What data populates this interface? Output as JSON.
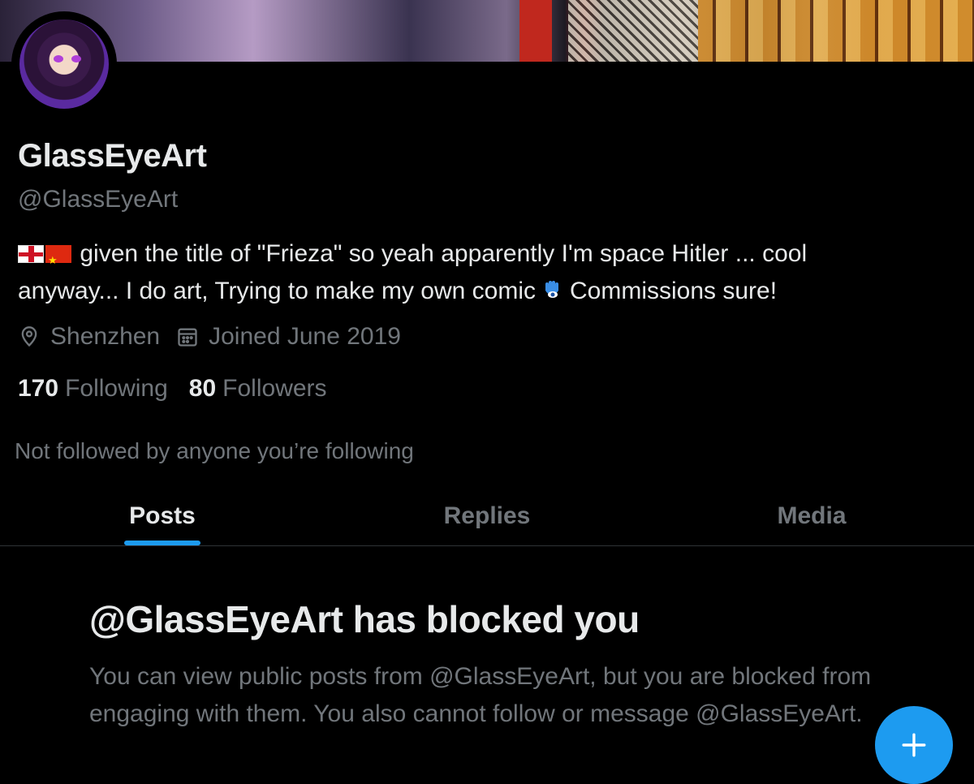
{
  "profile": {
    "display_name": "GlassEyeArt",
    "handle": "@GlassEyeArt",
    "bio_line1": "given the title of \"Frieza\" so yeah apparently I'm space Hitler ... cool",
    "bio_line2_a": "anyway... I do art, Trying to make my own comic",
    "bio_line2_b": "Commissions sure!",
    "location": "Shenzhen",
    "joined": "Joined June 2019",
    "following_count": "170",
    "following_label": "Following",
    "followers_count": "80",
    "followers_label": "Followers",
    "not_followed_text": "Not followed by anyone you’re following"
  },
  "tabs": [
    {
      "label": "Posts",
      "active": true
    },
    {
      "label": "Replies",
      "active": false
    },
    {
      "label": "Media",
      "active": false
    }
  ],
  "blocked": {
    "title": "@GlassEyeArt has blocked you",
    "message": "You can view public posts from @GlassEyeArt, but you are blocked from engaging with them. You also cannot follow or message @GlassEyeArt."
  },
  "icons": {
    "location": "location-pin-icon",
    "calendar": "calendar-icon",
    "compose": "plus-icon"
  },
  "colors": {
    "accent": "#1d9bf0",
    "muted": "#71767b",
    "text": "#e7e9ea",
    "background": "#000000"
  }
}
